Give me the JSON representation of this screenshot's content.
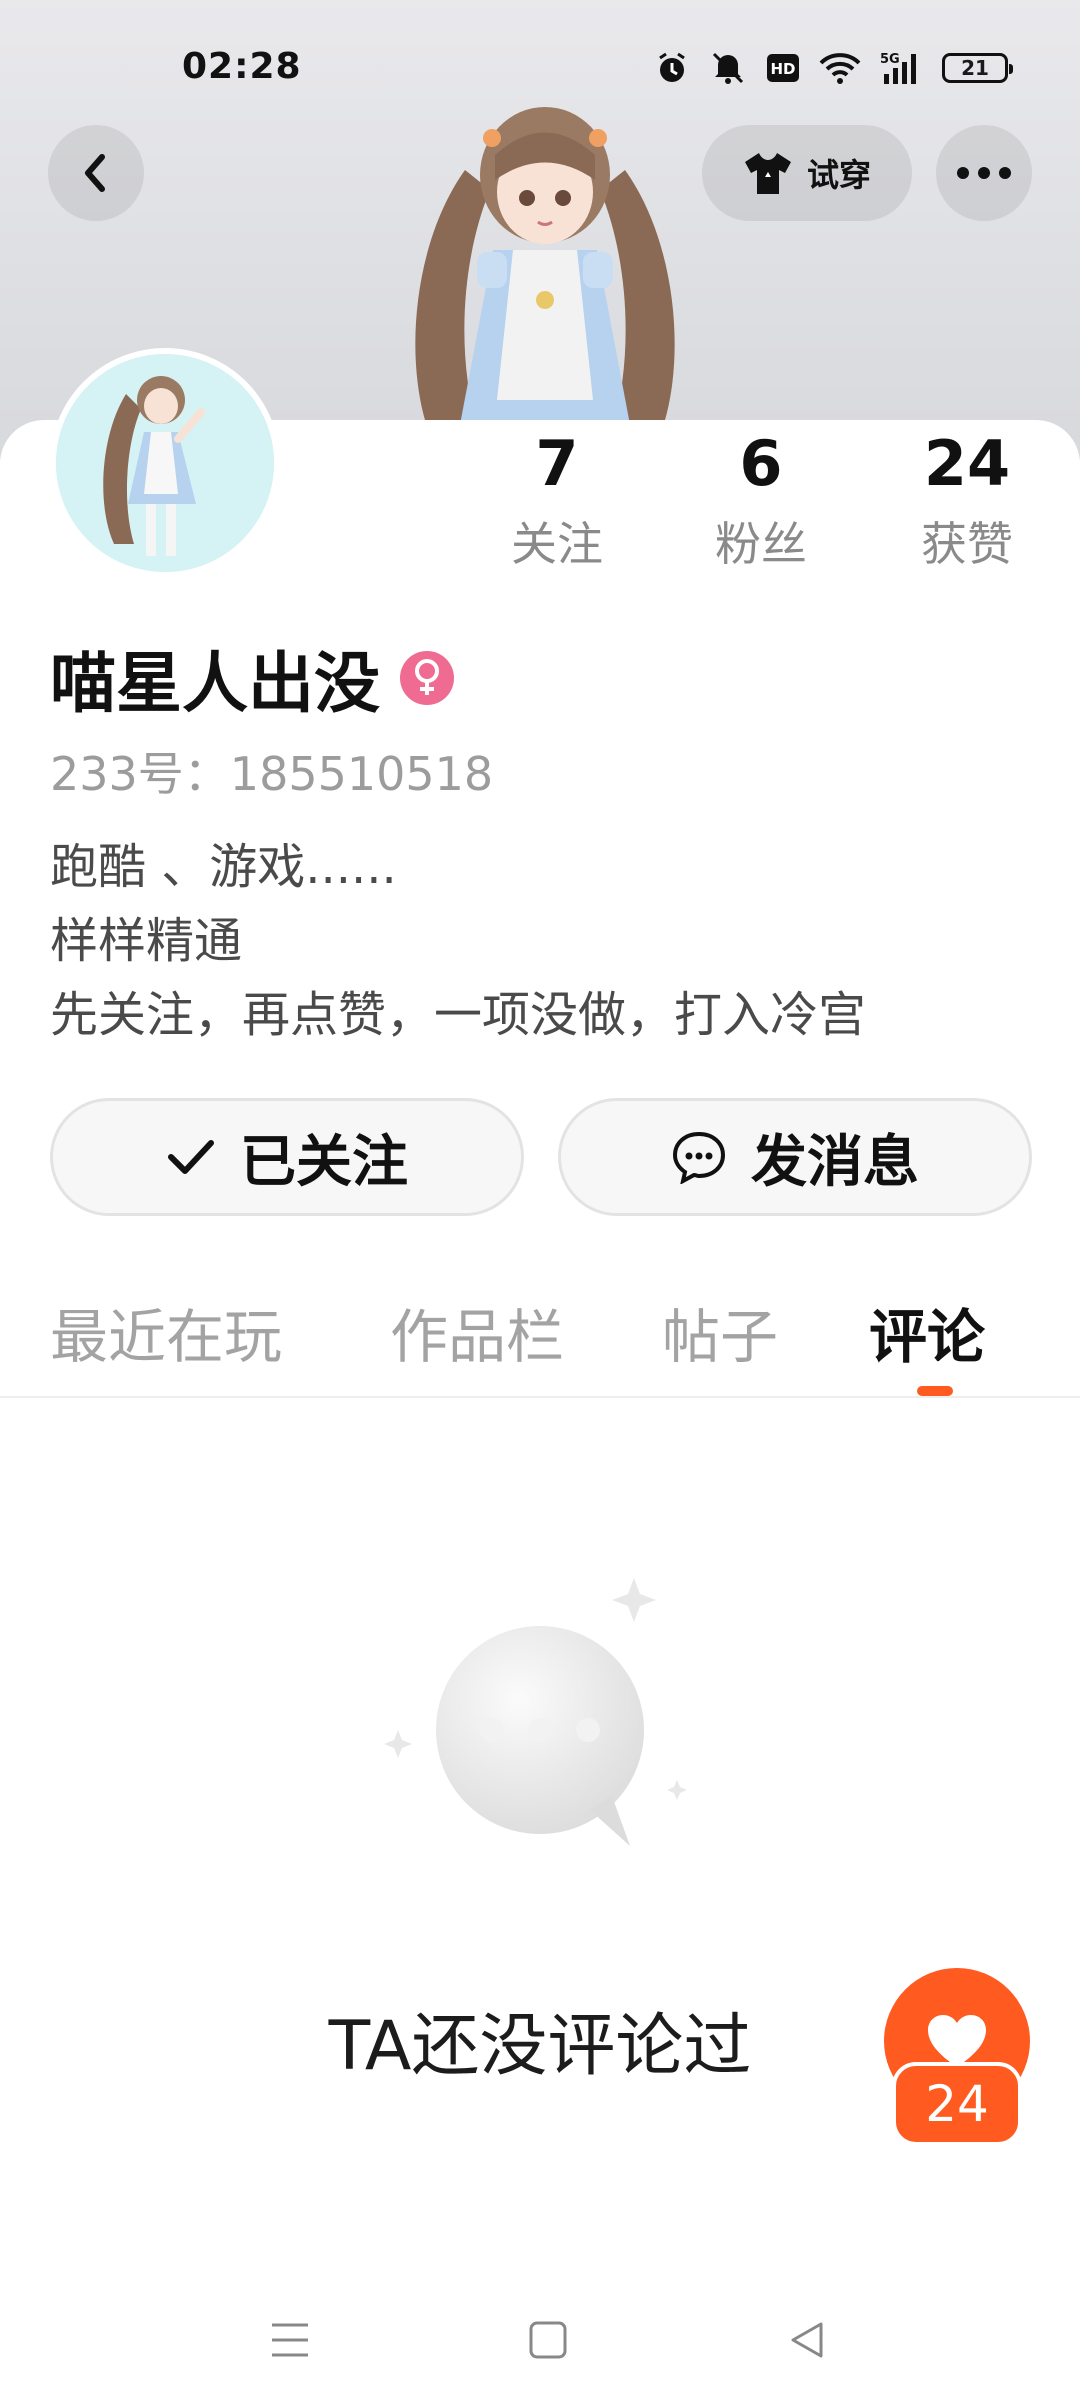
{
  "status_bar": {
    "time": "02:28",
    "battery": "21",
    "icons": [
      "alarm-icon",
      "mute-icon",
      "hd-icon",
      "wifi-icon",
      "signal-5g-icon",
      "battery-icon"
    ]
  },
  "header": {
    "back_icon": "chevron-left-icon",
    "tryon_label": "试穿",
    "tryon_icon": "shirt-icon",
    "more_icon": "more-dots-icon"
  },
  "profile": {
    "stats": [
      {
        "value": "7",
        "label": "关注"
      },
      {
        "value": "6",
        "label": "粉丝"
      },
      {
        "value": "24",
        "label": "获赞"
      }
    ],
    "username": "喵星人出没",
    "gender_icon": "female-icon",
    "user_id": "233号：185510518",
    "bio_lines": [
      "跑酷 、游戏......",
      "样样精通",
      "先关注，再点赞，一项没做，打入冷宫"
    ]
  },
  "actions": {
    "follow_label": "已关注",
    "message_label": "发消息"
  },
  "tabs": [
    {
      "label": "最近在玩",
      "active": false
    },
    {
      "label": "作品栏",
      "active": false
    },
    {
      "label": "帖子",
      "active": false
    },
    {
      "label": "评论",
      "active": true
    }
  ],
  "empty_state": {
    "text": "TA还没评论过",
    "icon": "chat-bubble-icon"
  },
  "like_float": {
    "count": "24",
    "icon": "heart-icon"
  },
  "nav_bar": {
    "icons": [
      "menu-icon",
      "home-icon",
      "back-icon"
    ]
  },
  "colors": {
    "accent": "#ff5a1f",
    "female_badge": "#f06b91",
    "muted_text": "#9c9c9c"
  }
}
